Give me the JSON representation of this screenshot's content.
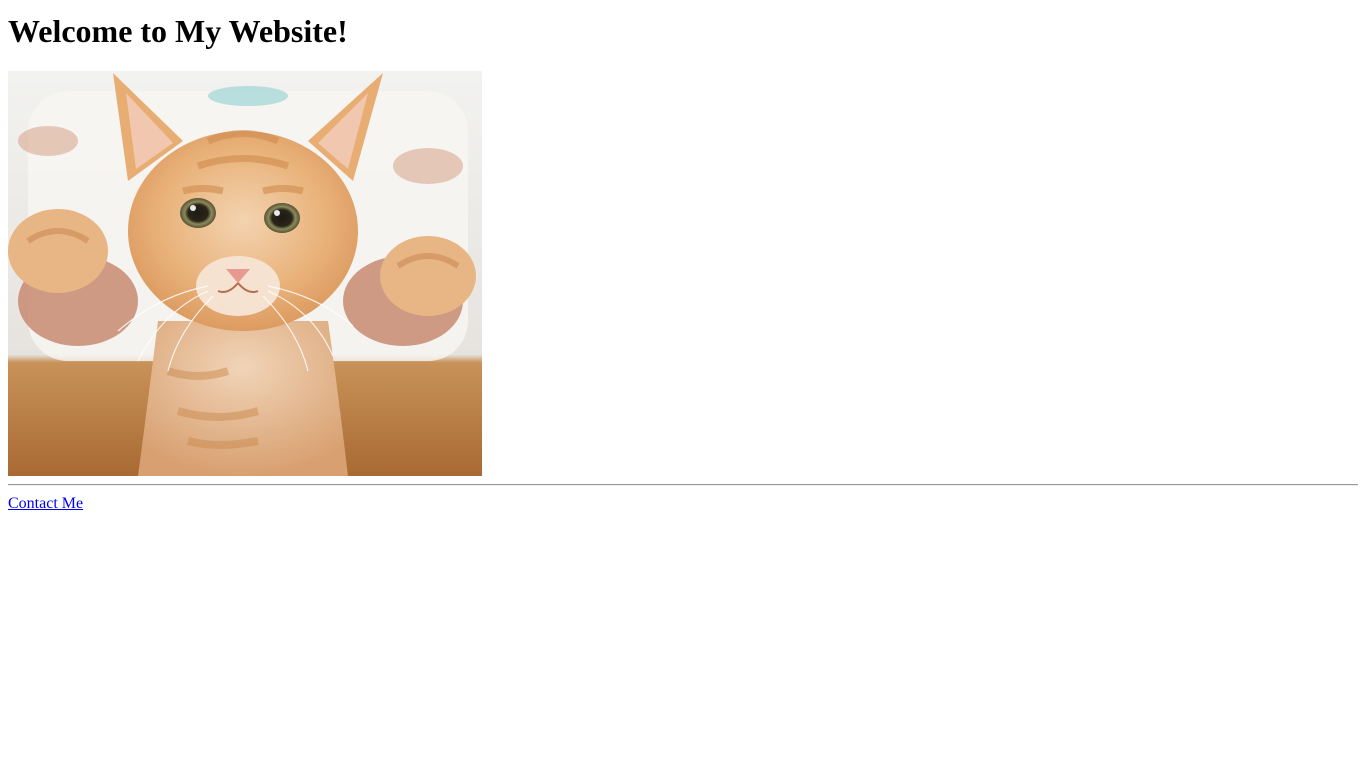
{
  "page": {
    "heading": "Welcome to My Website!",
    "image_subject": "orange-tabby-kitten-photo",
    "contact_link_label": "Contact Me"
  },
  "colors": {
    "background": "#ffffff",
    "text": "#000000",
    "link": "#0000ee",
    "divider": "#9a9a9a"
  }
}
